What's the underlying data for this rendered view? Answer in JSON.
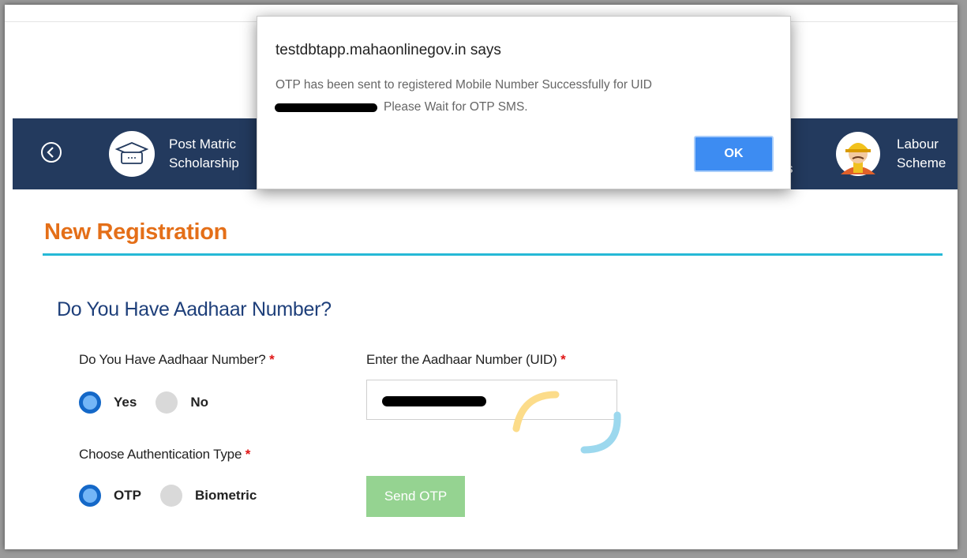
{
  "header": {
    "scheme_1": {
      "line1": "Post Matric",
      "line2": "Scholarship"
    },
    "scheme_2": {
      "line1": "Labour",
      "line2": "Scheme"
    },
    "partial_text": "s"
  },
  "page": {
    "title": "New Registration",
    "section_title": "Do You Have Aadhaar Number?"
  },
  "form": {
    "aadhaar_question": {
      "label": "Do You Have Aadhaar Number?",
      "required_mark": "*",
      "options": [
        "Yes",
        "No"
      ],
      "selected": "Yes"
    },
    "aadhaar_number": {
      "label": "Enter the Aadhaar Number (UID)",
      "required_mark": "*"
    },
    "auth_type": {
      "label": "Choose Authentication Type",
      "required_mark": "*",
      "options": [
        "OTP",
        "Biometric"
      ],
      "selected": "OTP"
    },
    "send_otp_label": "Send OTP"
  },
  "dialog": {
    "title": "testdbtapp.mahaonlinegov.in says",
    "message_line1": "OTP has been sent to registered Mobile Number Successfully for UID",
    "message_line2": "Please Wait for OTP SMS.",
    "ok_label": "OK"
  },
  "colors": {
    "navbar": "#233a5e",
    "title_orange": "#e46f18",
    "section_blue": "#1e3f7a",
    "accent_cyan": "#26b9d6",
    "send_otp_green": "#95d391",
    "ok_blue": "#3d8cf2"
  }
}
